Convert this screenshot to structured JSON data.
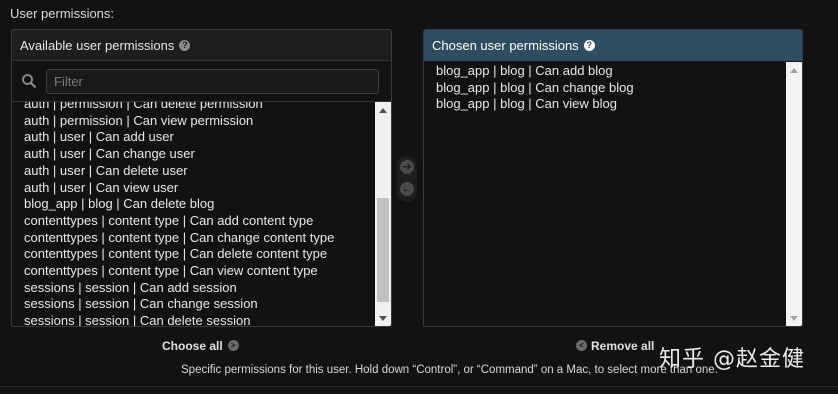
{
  "field_label": "User permissions:",
  "available": {
    "title": "Available user permissions",
    "help_icon": "?",
    "filter_placeholder": "Filter",
    "options": [
      "auth | permission | Can delete permission",
      "auth | permission | Can view permission",
      "auth | user | Can add user",
      "auth | user | Can change user",
      "auth | user | Can delete user",
      "auth | user | Can view user",
      "blog_app | blog | Can delete blog",
      "contenttypes | content type | Can add content type",
      "contenttypes | content type | Can change content type",
      "contenttypes | content type | Can delete content type",
      "contenttypes | content type | Can view content type",
      "sessions | session | Can add session",
      "sessions | session | Can change session",
      "sessions | session | Can delete session"
    ]
  },
  "chosen": {
    "title": "Chosen user permissions",
    "help_icon": "?",
    "options": [
      "blog_app | blog | Can add blog",
      "blog_app | blog | Can change blog",
      "blog_app | blog | Can view blog"
    ]
  },
  "actions": {
    "choose_all": "Choose all",
    "remove_all": "Remove all"
  },
  "help_text": "Specific permissions for this user. Hold down “Control”, or “Command” on a Mac, to select more than one.",
  "watermark": "知乎 @赵金健",
  "icons": {
    "search": "search-icon",
    "add": "arrow-right-icon",
    "remove": "arrow-left-icon"
  }
}
